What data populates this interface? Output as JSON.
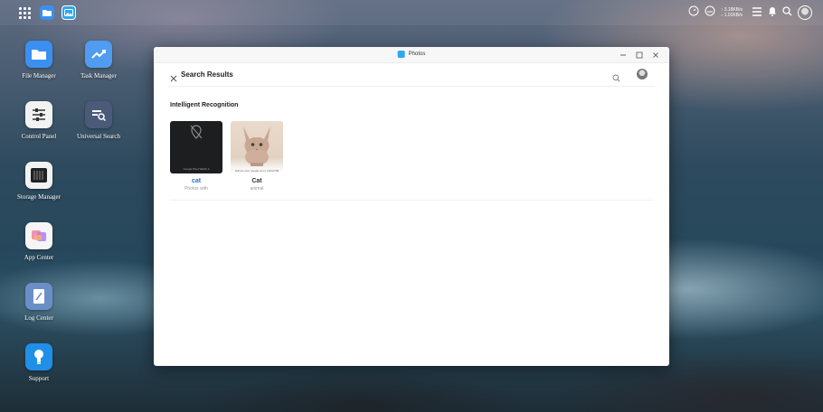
{
  "topbar": {
    "speed_up": "↑ 3.18KB/s",
    "speed_down": "↓ 1.01KB/s"
  },
  "desktop": {
    "icons": [
      {
        "label": "File Manager",
        "icon": "folder-icon"
      },
      {
        "label": "Task Manager",
        "icon": "chart-icon"
      },
      {
        "label": "Control Panel",
        "icon": "sliders-icon"
      },
      {
        "label": "Universal Search",
        "icon": "search-icon"
      },
      {
        "label": "Storage Manager",
        "icon": "storage-icon"
      },
      {
        "label": "App Center",
        "icon": "app-center-icon"
      },
      {
        "label": "Log Center",
        "icon": "log-icon"
      },
      {
        "label": "Support",
        "icon": "lightbulb-icon"
      }
    ]
  },
  "window": {
    "title": "Photos",
    "header_title": "Search Results",
    "section_title": "Intelligent Recognition",
    "results": [
      {
        "name": "cat",
        "sub": "Photos with",
        "caption": "Google Pixel Watch 2"
      },
      {
        "name": "Cat",
        "sub": "animal",
        "caption": "Sphynx cat | google.com | 1024x768"
      }
    ]
  },
  "colors": {
    "accent": "#2a6dbd",
    "files_tile": "#3b8ff0",
    "photos_tile": "#2aa8f0"
  }
}
